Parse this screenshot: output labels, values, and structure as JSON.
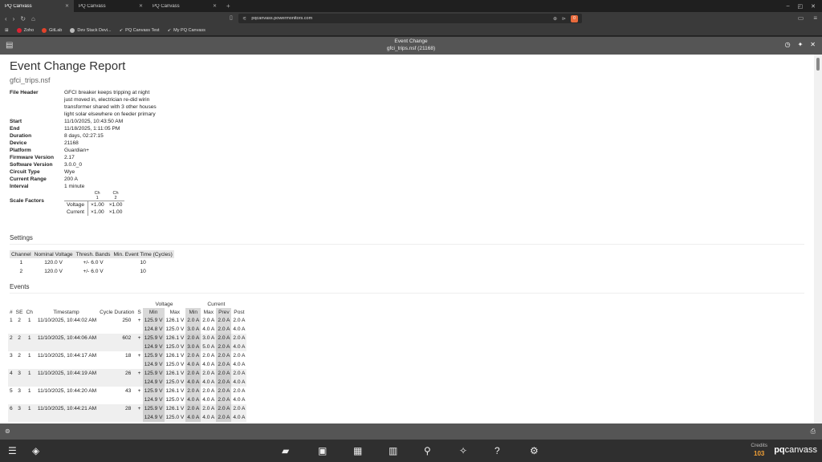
{
  "browser": {
    "tabs": [
      {
        "label": "PQ Canvass",
        "active": true
      },
      {
        "label": "PQ Canvass",
        "active": false
      },
      {
        "label": "PQ Canvass",
        "active": false
      }
    ],
    "url": "pqcanvass.powermonitors.com",
    "brave_badge": "0",
    "bookmarks": [
      "Zoho",
      "GitLab",
      "Dev Stack Devi...",
      "PQ Canvass Test",
      "My PQ Canvass"
    ]
  },
  "app_header": {
    "title": "Event Change",
    "subtitle": "gfci_trips.nsf (21168)"
  },
  "report": {
    "title": "Event Change Report",
    "filename": "gfci_trips.nsf",
    "info": [
      {
        "key": "File Header",
        "value": "GFCI breaker keeps tripping at night\njust moved in, electrician re-did wirin\ntransformer shared with 3 other houses\nlight solar elsewhere on feeder primary"
      },
      {
        "key": "Start",
        "value": "11/10/2025, 10:43:50 AM"
      },
      {
        "key": "End",
        "value": "11/18/2025, 1:11:05 PM"
      },
      {
        "key": "Duration",
        "value": "8 days, 02:27:15"
      },
      {
        "key": "Device",
        "value": "21168"
      },
      {
        "key": "Platform",
        "value": "Guardian+"
      },
      {
        "key": "Firmware Version",
        "value": "2.17"
      },
      {
        "key": "Software Version",
        "value": "3.0.0_0"
      },
      {
        "key": "Circuit Type",
        "value": "Wye"
      },
      {
        "key": "Current Range",
        "value": "200 A"
      },
      {
        "key": "Interval",
        "value": "1 minute"
      }
    ],
    "scale_factors": {
      "label": "Scale Factors",
      "columns": [
        "Ch 1",
        "Ch 2"
      ],
      "rows": [
        {
          "label": "Voltage",
          "values": [
            "×1.00",
            "×1.00"
          ]
        },
        {
          "label": "Current",
          "values": [
            "×1.00",
            "×1.00"
          ]
        }
      ]
    },
    "settings": {
      "heading": "Settings",
      "columns": [
        "Channel",
        "Nominal Voltage",
        "Thresh. Bands",
        "Min. Event Time (Cycles)"
      ],
      "rows": [
        [
          "1",
          "120.0 V",
          "+/- 6.0 V",
          "10"
        ],
        [
          "2",
          "120.0 V",
          "+/- 6.0 V",
          "10"
        ]
      ]
    },
    "events": {
      "heading": "Events",
      "group_voltage": "Voltage",
      "group_current": "Current",
      "columns": [
        "#",
        "SE",
        "Ch",
        "Timestamp",
        "Cycle Duration",
        "S",
        "Min",
        "Max",
        "Min",
        "Max",
        "Prev",
        "Post"
      ],
      "rows": [
        {
          "n": "1",
          "se": "2",
          "ch": "1",
          "ts": "11/10/2025, 10:44:02 AM",
          "dur": "250",
          "s": "+",
          "lines": [
            [
              "125.9 V",
              "126.1 V",
              "2.0 A",
              "2.0 A",
              "2.0 A",
              "2.0 A"
            ],
            [
              "124.8 V",
              "125.0 V",
              "3.0 A",
              "4.0 A",
              "2.0 A",
              "4.0 A"
            ]
          ]
        },
        {
          "n": "2",
          "se": "2",
          "ch": "1",
          "ts": "11/10/2025, 10:44:06 AM",
          "dur": "602",
          "s": "+",
          "lines": [
            [
              "125.9 V",
              "126.1 V",
              "2.0 A",
              "3.0 A",
              "2.0 A",
              "2.0 A"
            ],
            [
              "124.9 V",
              "125.0 V",
              "3.0 A",
              "5.0 A",
              "2.0 A",
              "4.0 A"
            ]
          ]
        },
        {
          "n": "3",
          "se": "2",
          "ch": "1",
          "ts": "11/10/2025, 10:44:17 AM",
          "dur": "18",
          "s": "+",
          "lines": [
            [
              "125.9 V",
              "126.1 V",
              "2.0 A",
              "2.0 A",
              "2.0 A",
              "2.0 A"
            ],
            [
              "124.9 V",
              "125.0 V",
              "4.0 A",
              "4.0 A",
              "2.0 A",
              "4.0 A"
            ]
          ]
        },
        {
          "n": "4",
          "se": "3",
          "ch": "1",
          "ts": "11/10/2025, 10:44:19 AM",
          "dur": "26",
          "s": "+",
          "lines": [
            [
              "125.9 V",
              "126.1 V",
              "2.0 A",
              "2.0 A",
              "2.0 A",
              "2.0 A"
            ],
            [
              "124.9 V",
              "125.0 V",
              "4.0 A",
              "4.0 A",
              "2.0 A",
              "4.0 A"
            ]
          ]
        },
        {
          "n": "5",
          "se": "3",
          "ch": "1",
          "ts": "11/10/2025, 10:44:20 AM",
          "dur": "43",
          "s": "+",
          "lines": [
            [
              "125.9 V",
              "126.1 V",
              "2.0 A",
              "2.0 A",
              "2.0 A",
              "2.0 A"
            ],
            [
              "124.9 V",
              "125.0 V",
              "4.0 A",
              "4.0 A",
              "2.0 A",
              "4.0 A"
            ]
          ]
        },
        {
          "n": "6",
          "se": "3",
          "ch": "1",
          "ts": "11/10/2025, 10:44:21 AM",
          "dur": "28",
          "s": "+",
          "lines": [
            [
              "125.9 V",
              "126.1 V",
              "2.0 A",
              "2.0 A",
              "2.0 A",
              "2.0 A"
            ],
            [
              "124.9 V",
              "125.0 V",
              "4.0 A",
              "4.0 A",
              "2.0 A",
              "4.0 A"
            ]
          ]
        }
      ]
    }
  },
  "footer": {
    "credits_label": "Credits",
    "credits_value": "103",
    "logo_pq": "pq",
    "logo_rest": "canvass"
  },
  "colors": {
    "accent": "#f2a036",
    "header_bg": "#555555",
    "appbar_bg": "#2f2f2f"
  }
}
